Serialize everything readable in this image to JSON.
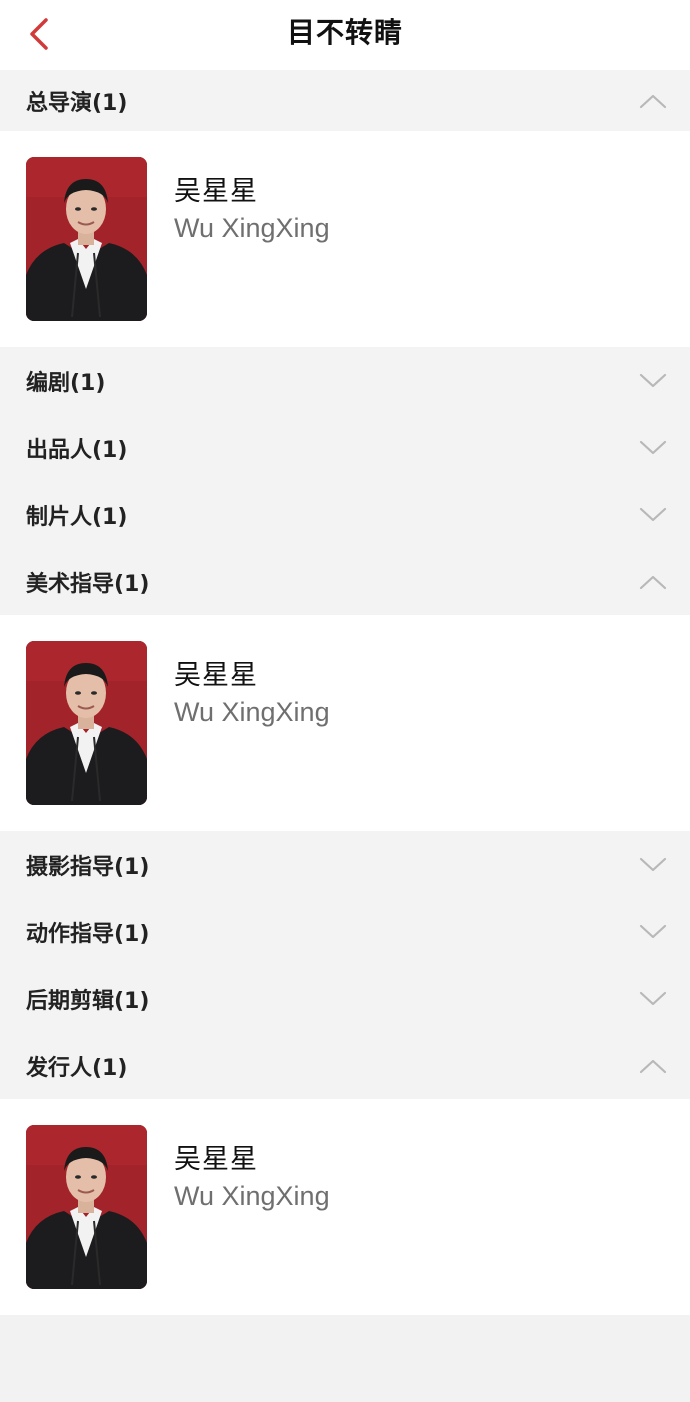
{
  "nav": {
    "title": "目不转睛",
    "back_icon": "chevron-left-icon",
    "accent_color": "#d23a3a"
  },
  "sections": [
    {
      "title": "总导演(1)",
      "expanded": true,
      "people": [
        {
          "name": "吴星星",
          "latin_name": "Wu XingXing",
          "avatar": "person-photo-red-backdrop"
        }
      ]
    },
    {
      "title": "编剧(1)",
      "expanded": false,
      "people": []
    },
    {
      "title": "出品人(1)",
      "expanded": false,
      "people": []
    },
    {
      "title": "制片人(1)",
      "expanded": false,
      "people": []
    },
    {
      "title": "美术指导(1)",
      "expanded": true,
      "people": [
        {
          "name": "吴星星",
          "latin_name": "Wu XingXing",
          "avatar": "person-photo-red-backdrop"
        }
      ]
    },
    {
      "title": "摄影指导(1)",
      "expanded": false,
      "people": []
    },
    {
      "title": "动作指导(1)",
      "expanded": false,
      "people": []
    },
    {
      "title": "后期剪辑(1)",
      "expanded": false,
      "people": []
    },
    {
      "title": "发行人(1)",
      "expanded": true,
      "people": [
        {
          "name": "吴星星",
          "latin_name": "Wu XingXing",
          "avatar": "person-photo-red-backdrop"
        }
      ]
    }
  ],
  "colors": {
    "page_background": "#f2f2f2",
    "header_background": "#f3f3f3",
    "card_background": "#ffffff",
    "chevron": "#b8b8b8",
    "secondary_text": "#6f6f6f"
  }
}
